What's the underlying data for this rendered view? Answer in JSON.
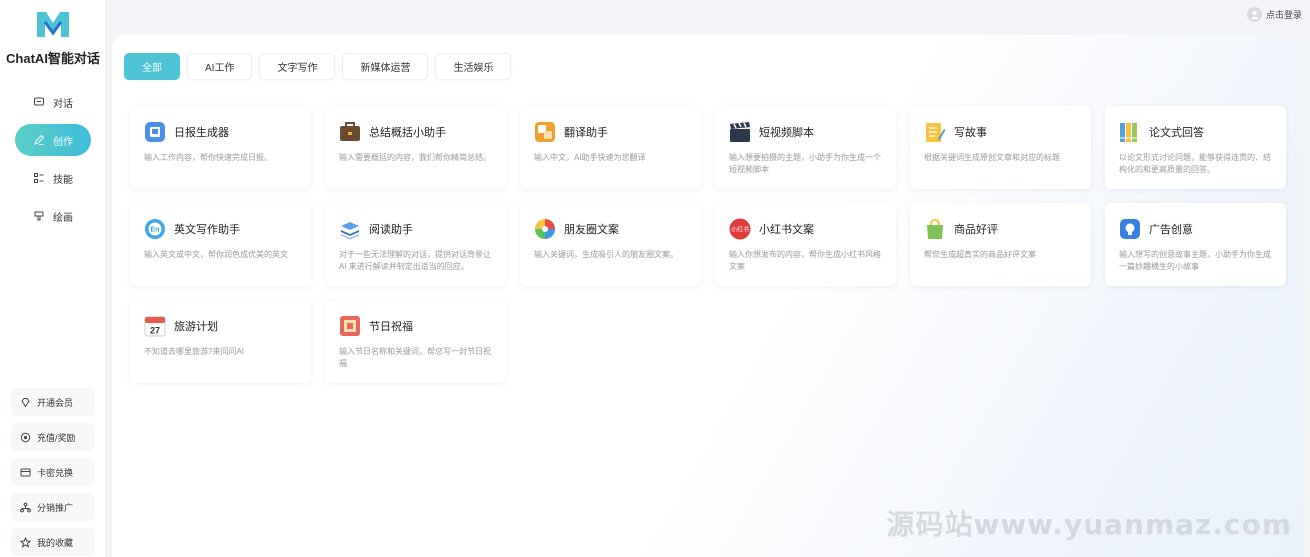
{
  "app": {
    "name": "ChatAI智能对话"
  },
  "header": {
    "login_label": "点击登录"
  },
  "nav": [
    {
      "label": "对话",
      "icon": "chat-icon",
      "active": false
    },
    {
      "label": "创作",
      "icon": "pen-icon",
      "active": true
    },
    {
      "label": "技能",
      "icon": "list-icon",
      "active": false
    },
    {
      "label": "绘画",
      "icon": "paint-icon",
      "active": false
    }
  ],
  "bottom_menu": [
    {
      "label": "开通会员",
      "icon": "diamond-icon"
    },
    {
      "label": "充值/奖励",
      "icon": "coin-icon"
    },
    {
      "label": "卡密兑换",
      "icon": "card-icon"
    },
    {
      "label": "分销推广",
      "icon": "share-icon"
    },
    {
      "label": "我的收藏",
      "icon": "star-icon"
    }
  ],
  "tabs": [
    {
      "label": "全部",
      "active": true
    },
    {
      "label": "AI工作",
      "active": false
    },
    {
      "label": "文字写作",
      "active": false
    },
    {
      "label": "新媒体运营",
      "active": false
    },
    {
      "label": "生活娱乐",
      "active": false
    }
  ],
  "cards": [
    {
      "title": "日报生成器",
      "desc": "输入工作内容，帮你快速完成日报。",
      "icon": "daily-report-icon",
      "color": "#4a8fe8"
    },
    {
      "title": "总结概括小助手",
      "desc": "输入需要概括的内容，我们帮你精简总结。",
      "icon": "briefcase-icon",
      "color": "#6b4a2e"
    },
    {
      "title": "翻译助手",
      "desc": "输入中文，AI助手快速为您翻译",
      "icon": "translate-icon",
      "color": "#f0a030"
    },
    {
      "title": "短视频脚本",
      "desc": "输入想要拍摄的主题，小助手为你生成一个短视频脚本",
      "icon": "clapperboard-icon",
      "color": "#2b3a4a"
    },
    {
      "title": "写故事",
      "desc": "根据关键词生成原创文章和对应的标题",
      "icon": "notepad-icon",
      "color": "#f5c242"
    },
    {
      "title": "论文式回答",
      "desc": "以论文形式讨论问题，能够获得连贯的、结构化的和更高质量的回答。",
      "icon": "binders-icon",
      "color": "#5aa0d8"
    },
    {
      "title": "英文写作助手",
      "desc": "输入英文或中文，帮你润色成优美的英文",
      "icon": "english-icon",
      "color": "#3fa6e8"
    },
    {
      "title": "阅读助手",
      "desc": "对于一些无法理解的对话，提供对话背景让 AI 来进行解读并制定出适当的回应。",
      "icon": "books-icon",
      "color": "#3b6fb0"
    },
    {
      "title": "朋友圈文案",
      "desc": "输入关键词，生成吸引人的朋友圈文案。",
      "icon": "aperture-icon",
      "color": "#e84a4a"
    },
    {
      "title": "小红书文案",
      "desc": "输入你想发布的内容，帮你生成小红书风格文案",
      "icon": "xiaohongshu-icon",
      "color": "#e03a3a"
    },
    {
      "title": "商品好评",
      "desc": "帮您生成超真实的商品好评文案",
      "icon": "shopping-bag-icon",
      "color": "#7cc35a"
    },
    {
      "title": "广告创意",
      "desc": "输入想写的创意故事主题，小助手为你生成一篇妙趣横生的小故事",
      "icon": "lightbulb-icon",
      "color": "#3a7ee0"
    },
    {
      "title": "旅游计划",
      "desc": "不知道去哪里旅游?来问问AI",
      "icon": "calendar-icon",
      "color": "#e85a4a",
      "badge": "27"
    },
    {
      "title": "节日祝福",
      "desc": "输入节日名称和关键词，帮您写一封节日祝福",
      "icon": "festival-icon",
      "color": "#e8665a"
    }
  ],
  "watermark": "源码站www.yuanmaz.com"
}
